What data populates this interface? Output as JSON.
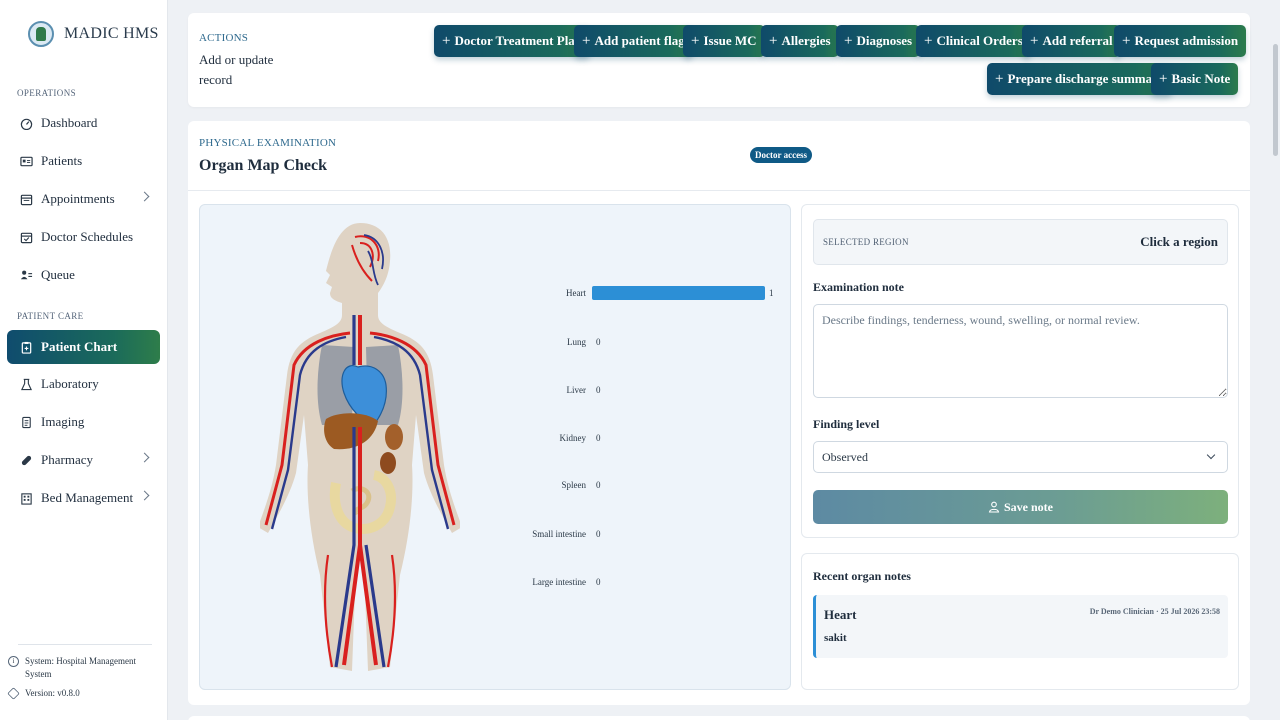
{
  "brand": {
    "name": "MADIC HMS"
  },
  "sidebar": {
    "sections": [
      {
        "label": "OPERATIONS"
      },
      {
        "label": "PATIENT CARE"
      }
    ],
    "items": [
      {
        "label": "Dashboard",
        "icon": "dashboard-icon"
      },
      {
        "label": "Patients",
        "icon": "id-card-icon"
      },
      {
        "label": "Appointments",
        "icon": "calendar-icon"
      },
      {
        "label": "Doctor Schedules",
        "icon": "calendar-check-icon"
      },
      {
        "label": "Queue",
        "icon": "queue-icon"
      },
      {
        "label": "Patient Chart",
        "icon": "clipboard-icon"
      },
      {
        "label": "Laboratory",
        "icon": "flask-icon"
      },
      {
        "label": "Imaging",
        "icon": "file-icon"
      },
      {
        "label": "Pharmacy",
        "icon": "pill-icon"
      },
      {
        "label": "Bed Management",
        "icon": "building-icon"
      }
    ],
    "footer": {
      "system": "System: Hospital Management System",
      "version": "Version: v0.8.0"
    }
  },
  "actions": {
    "label": "ACTIONS",
    "subtitle": "Add or update record",
    "buttons": [
      "Doctor Treatment Plan",
      "Add patient flag",
      "Issue MC",
      "Allergies",
      "Diagnoses",
      "Clinical Orders",
      "Add referral",
      "Request admission",
      "Prepare discharge summary",
      "Basic Note"
    ]
  },
  "exam": {
    "label": "PHYSICAL EXAMINATION",
    "title": "Organ Map Check",
    "badge": "Doctor access",
    "organs": [
      {
        "name": "Heart",
        "count": 1
      },
      {
        "name": "Lung",
        "count": 0
      },
      {
        "name": "Liver",
        "count": 0
      },
      {
        "name": "Kidney",
        "count": 0
      },
      {
        "name": "Spleen",
        "count": 0
      },
      {
        "name": "Small intestine",
        "count": 0
      },
      {
        "name": "Large intestine",
        "count": 0
      }
    ],
    "selected_region_label": "SELECTED REGION",
    "selected_region_value": "Click a region",
    "note_label": "Examination note",
    "note_placeholder": "Describe findings, tenderness, wound, swelling, or normal review.",
    "finding_label": "Finding level",
    "finding_value": "Observed",
    "save_label": "Save note"
  },
  "recent": {
    "title": "Recent organ notes",
    "notes": [
      {
        "organ": "Heart",
        "meta": "Dr Demo Clinician · 25 Jul 2026 23:58",
        "text": "sakit"
      }
    ]
  },
  "colors": {
    "accent": "#0f4c6e",
    "accent_green": "#2e7d4a",
    "bar": "#2c8fd6",
    "artery": "#d9201e",
    "vein": "#2a3a8c"
  }
}
